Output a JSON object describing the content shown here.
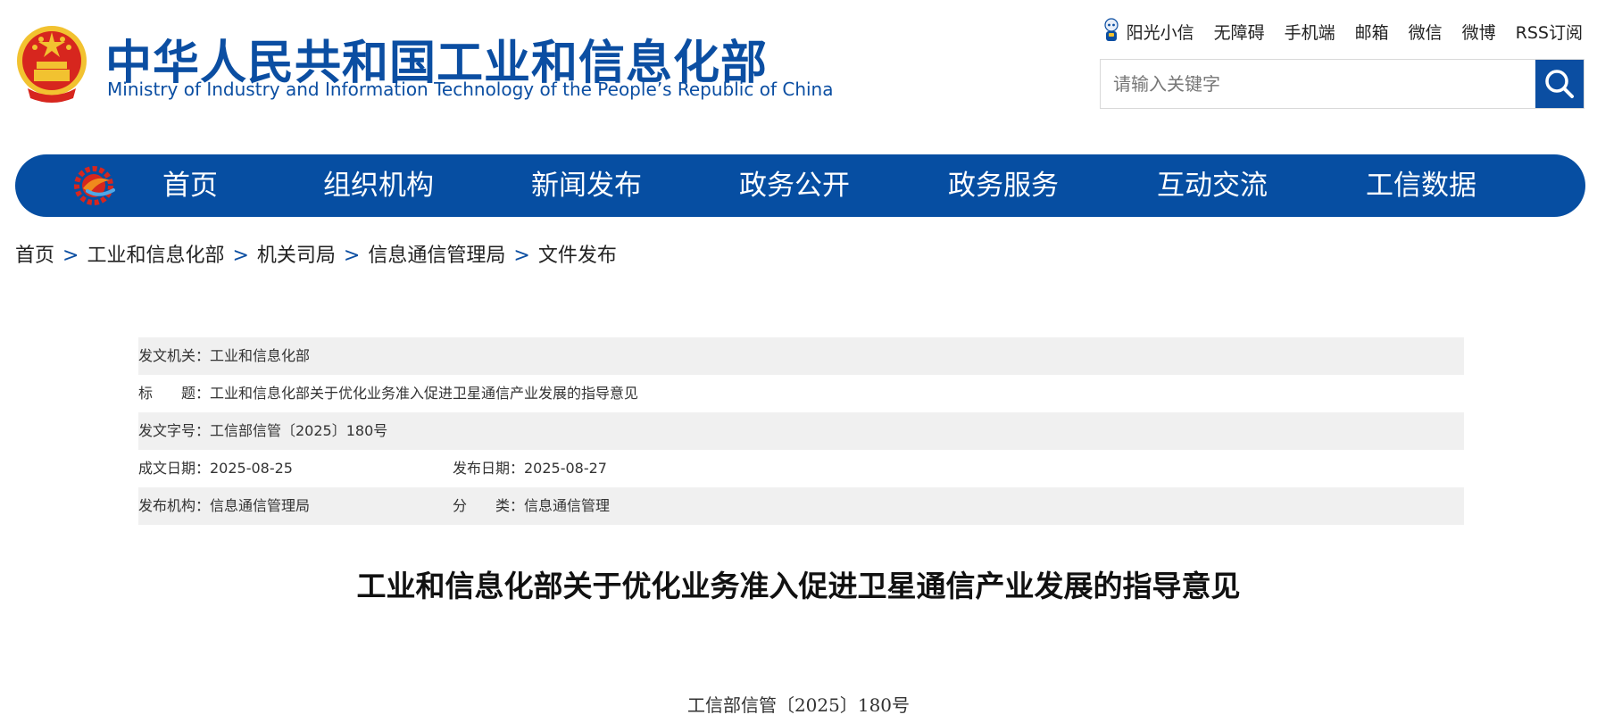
{
  "header": {
    "title": "中华人民共和国工业和信息化部",
    "subtitle": "Ministry of Industry and Information Technology of the People’s Republic of China"
  },
  "top_links": [
    "阳光小信",
    "无障碍",
    "手机端",
    "邮箱",
    "微信",
    "微博",
    "RSS订阅"
  ],
  "search": {
    "placeholder": "请输入关键字"
  },
  "nav": {
    "items": [
      "首页",
      "组织机构",
      "新闻发布",
      "政务公开",
      "政务服务",
      "互动交流",
      "工信数据"
    ]
  },
  "breadcrumb": {
    "items": [
      "首页",
      "工业和信息化部",
      "机关司局",
      "信息通信管理局",
      "文件发布"
    ],
    "separator": ">"
  },
  "meta": {
    "issuer": "发文机关：工业和信息化部",
    "title": "标　　题：工业和信息化部关于优化业务准入促进卫星通信产业发展的指导意见",
    "doc_number": "发文字号：工信部信管〔2025〕180号",
    "created_date": "成文日期：2025-08-25",
    "published_date": "发布日期：2025-08-27",
    "agency": "发布机构：信息通信管理局",
    "category": "分　　类：信息通信管理"
  },
  "article": {
    "title": "工业和信息化部关于优化业务准入促进卫星通信产业发展的指导意见",
    "doc_number": "工信部信管〔2025〕180号"
  },
  "colors": {
    "brand_blue": "#064ea2",
    "emblem_red": "#d7261e",
    "emblem_gold": "#f2c230"
  }
}
